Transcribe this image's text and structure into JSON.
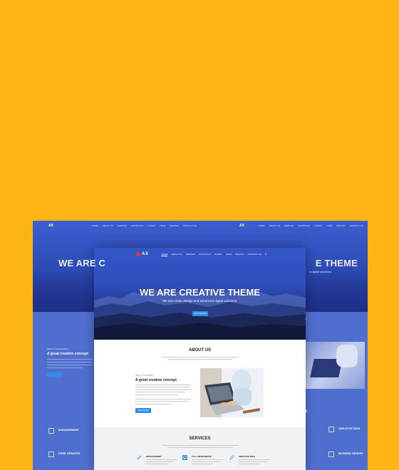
{
  "brand": {
    "logo_text": "AX"
  },
  "nav": {
    "items": [
      "HOME",
      "ABOUT US",
      "SERVICE",
      "PORTFOLIO",
      "CLIENT",
      "TEAM",
      "PRICING",
      "CONTACT US"
    ],
    "active_index": 0
  },
  "hero": {
    "title": "WE ARE CREATIVE THEME",
    "subtitle": "We love clean design and advanced digital solutions.",
    "button_label": "GET STARTED"
  },
  "about": {
    "heading": "ABOUT US",
    "kicker": "ABOUT OUR WORKS",
    "title": "A great creative concept",
    "button_label": "READ MORE"
  },
  "services": {
    "heading": "SERVICES",
    "items": [
      {
        "title": "MANAGEMENT",
        "icon": "pen-icon"
      },
      {
        "title": "FULL RESPONSIVE",
        "icon": "monitor-icon"
      },
      {
        "title": "CREATIVE IDEA",
        "icon": "pencil-icon"
      }
    ]
  },
  "background_left": {
    "headline": "WE ARE C",
    "features": [
      "MANAGEMENT",
      "FREE UPDATES"
    ]
  },
  "background_right": {
    "headline": "E THEME",
    "subtitle": "d digital solutions.",
    "features": [
      "CREATIVE IDEA",
      "MODERN DESIGN"
    ],
    "section_fragment": "S"
  },
  "colors": {
    "page_background": "#FDB515",
    "hero_blue": "#2F4EBC",
    "accent_button": "#2F8FE6",
    "logo_red": "#E53935",
    "services_background": "#F1F2F4"
  }
}
